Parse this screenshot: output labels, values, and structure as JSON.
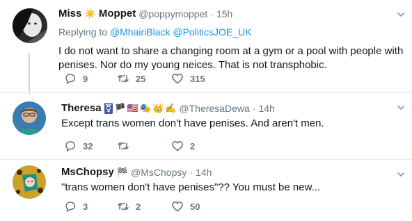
{
  "tweets": [
    {
      "display_name": "Miss ☀️ Moppet",
      "display_name_pre": "Miss",
      "display_name_emoji": "☀️",
      "display_name_post": "Moppet",
      "handle": "@poppymoppet",
      "dot": "·",
      "time": "15h",
      "replying_prefix": "Replying to",
      "replying_mentions": [
        "@MhairiBlack",
        "@PoliticsJOE_UK"
      ],
      "text": "I do not want to share a changing room at a gym or a pool with people with penises. Nor do my young neices. That is not transphobic.",
      "replies": "9",
      "retweets": "25",
      "likes": "315"
    },
    {
      "display_name": "Theresa",
      "name_emojis": [
        "⚧",
        "🏴",
        "🇺🇸",
        "🎭",
        "👑",
        "✍️"
      ],
      "handle": "@TheresaDewa",
      "dot": "·",
      "time": "14h",
      "text": "Except trans women don't have penises. And aren't men.",
      "replies": "32",
      "retweets": "",
      "likes": "2"
    },
    {
      "display_name": "MsChopsy",
      "name_emojis": [
        "🏁"
      ],
      "handle": "@MsChopsy",
      "dot": "·",
      "time": "14h",
      "text": "\"trans women don't have penises\"?? You must be new...",
      "replies": "3",
      "retweets": "2",
      "likes": "50"
    }
  ],
  "colors": {
    "link": "#1b95e0",
    "muted": "#657786",
    "text": "#14171a",
    "divider": "#e6ecf0"
  }
}
